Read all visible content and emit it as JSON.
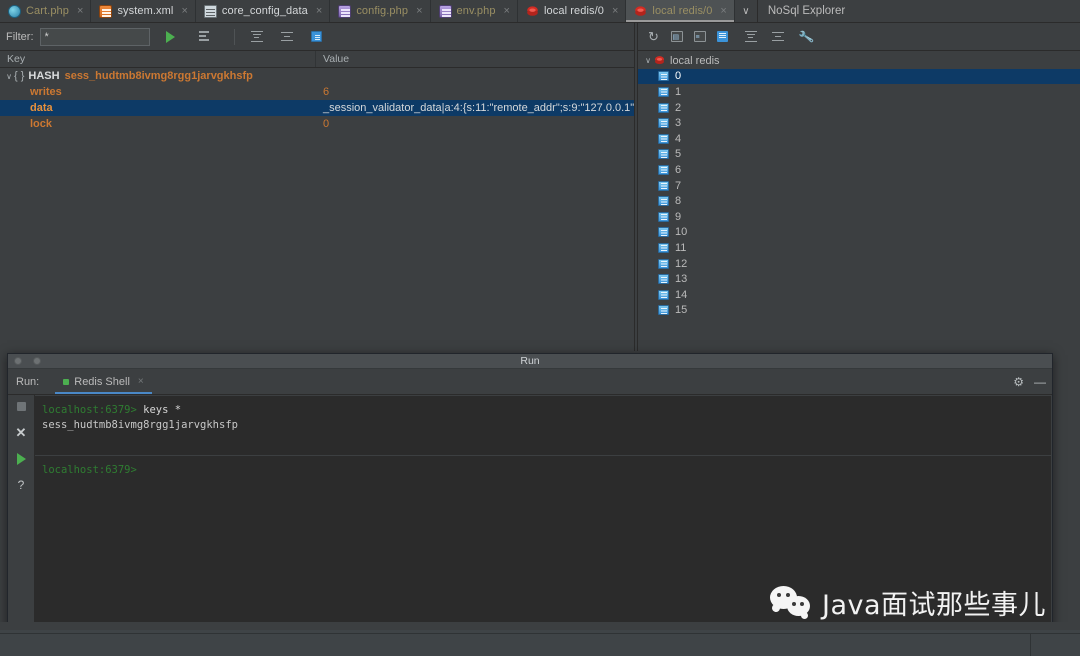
{
  "editor_tabs": [
    {
      "label": "Cart.php",
      "icon": "php-file-icon",
      "icon_kind": "php-blue",
      "active": false,
      "close": "×"
    },
    {
      "label": "system.xml",
      "icon": "xml-file-icon",
      "icon_kind": "xml",
      "active": false,
      "close": "×"
    },
    {
      "label": "core_config_data",
      "icon": "database-table-icon",
      "icon_kind": "table",
      "active": false,
      "close": "×"
    },
    {
      "label": "config.php",
      "icon": "php-file-icon",
      "icon_kind": "php-purple",
      "active": false,
      "close": "×"
    },
    {
      "label": "env.php",
      "icon": "php-file-icon",
      "icon_kind": "php-purple",
      "active": false,
      "close": "×"
    },
    {
      "label": "local redis/0",
      "icon": "redis-icon",
      "icon_kind": "redis",
      "active": false,
      "close": "×"
    },
    {
      "label": "local redis/0",
      "icon": "redis-icon",
      "icon_kind": "redis",
      "active": true,
      "close": "×"
    }
  ],
  "tabbar": {
    "overflow_label": "∨",
    "right_panel_title": "NoSql Explorer"
  },
  "key_toolbar": {
    "filter_label": "Filter:",
    "filter_value": "*",
    "filter_placeholder": "*",
    "run_icon": "run-play-icon",
    "script_icon": "execute-script-icon",
    "expand_icon": "expand-all-icon",
    "collapse_icon": "collapse-all-icon",
    "delete_icon": "delete-key-icon"
  },
  "key_table": {
    "columns": [
      "Key",
      "Value"
    ],
    "root": {
      "twisty": "∨",
      "brace": "{ }",
      "type": "HASH",
      "name": "sess_hudtmb8ivmg8rgg1jarvgkhsfp",
      "value": ""
    },
    "rows": [
      {
        "key": "writes",
        "value": "6",
        "selected": false
      },
      {
        "key": "data",
        "value": "_session_validator_data|a:4:{s:11:\"remote_addr\";s:9:\"127.0.0.1\"",
        "selected": true
      },
      {
        "key": "lock",
        "value": "0",
        "selected": false
      }
    ]
  },
  "explorer": {
    "title": "NoSql Explorer",
    "toolbar": {
      "refresh_icon": "refresh-icon",
      "add_icon": "add-server-icon",
      "query_icon": "query-icon",
      "delete_icon": "delete-icon",
      "expand_icon": "expand-all-icon",
      "collapse_icon": "collapse-all-icon",
      "settings_icon": "wrench-settings-icon"
    },
    "server": {
      "twisty": "∨",
      "label": "local redis",
      "icon": "redis-icon"
    },
    "databases": [
      {
        "label": "0",
        "selected": true
      },
      {
        "label": "1",
        "selected": false
      },
      {
        "label": "2",
        "selected": false
      },
      {
        "label": "3",
        "selected": false
      },
      {
        "label": "4",
        "selected": false
      },
      {
        "label": "5",
        "selected": false
      },
      {
        "label": "6",
        "selected": false
      },
      {
        "label": "7",
        "selected": false
      },
      {
        "label": "8",
        "selected": false
      },
      {
        "label": "9",
        "selected": false
      },
      {
        "label": "10",
        "selected": false
      },
      {
        "label": "11",
        "selected": false
      },
      {
        "label": "12",
        "selected": false
      },
      {
        "label": "13",
        "selected": false
      },
      {
        "label": "14",
        "selected": false
      },
      {
        "label": "15",
        "selected": false
      }
    ]
  },
  "run_window": {
    "window_title": "Run",
    "run_label": "Run:",
    "tab_label": "Redis Shell",
    "tab_close": "×",
    "gear_icon": "settings-gear-icon",
    "minimize_icon": "minimize-icon",
    "sidebar": {
      "stop_icon": "stop-icon",
      "close_icon": "close-icon",
      "rerun_icon": "rerun-play-icon",
      "help_icon": "help-question-icon"
    },
    "console": {
      "lines": [
        {
          "prompt": "localhost:6379>",
          "command": " keys *"
        },
        {
          "prompt": "",
          "command": "",
          "output": "sess_hudtmb8ivmg8rgg1jarvgkhsfp"
        }
      ],
      "current_prompt": "localhost:6379>"
    }
  },
  "watermark": {
    "text": "Java面试那些事儿",
    "icon": "wechat-icon"
  },
  "colors": {
    "background": "#3c3f41",
    "console_background": "#2b2b2b",
    "selection": "#0d3a66",
    "key_orange": "#cc7832",
    "prompt_green": "#2f7d32",
    "accent_blue": "#3b93d9",
    "play_green": "#4caf50"
  }
}
